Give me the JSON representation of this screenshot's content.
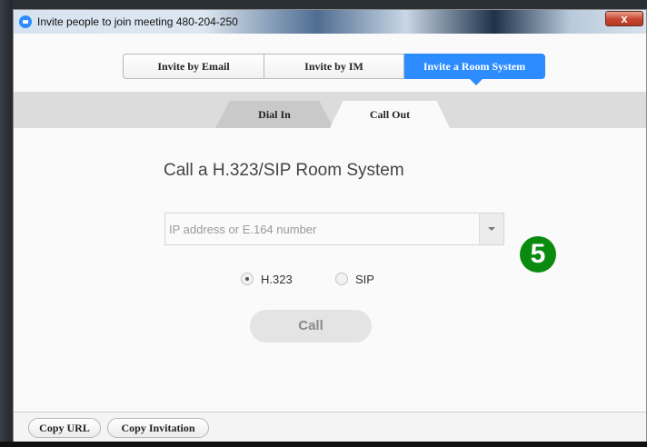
{
  "window": {
    "title": "Invite people to join meeting 480-204-250",
    "close_label": "x"
  },
  "invite_tabs": [
    {
      "label": "Invite by Email",
      "active": false
    },
    {
      "label": "Invite by IM",
      "active": false
    },
    {
      "label": "Invite a Room System",
      "active": true
    }
  ],
  "sub_tabs": [
    {
      "label": "Dial In",
      "active": false
    },
    {
      "label": "Call Out",
      "active": true
    }
  ],
  "main": {
    "heading": "Call a H.323/SIP Room System",
    "address_input": {
      "placeholder": "IP address or E.164 number",
      "value": ""
    },
    "protocols": [
      {
        "label": "H.323",
        "selected": true
      },
      {
        "label": "SIP",
        "selected": false
      }
    ],
    "call_button": "Call"
  },
  "step_badge": "5",
  "footer": {
    "copy_url": "Copy URL",
    "copy_invitation": "Copy Invitation"
  },
  "colors": {
    "accent": "#2d8cff",
    "badge_green": "#0b8a10",
    "close_red": "#c8452e"
  }
}
